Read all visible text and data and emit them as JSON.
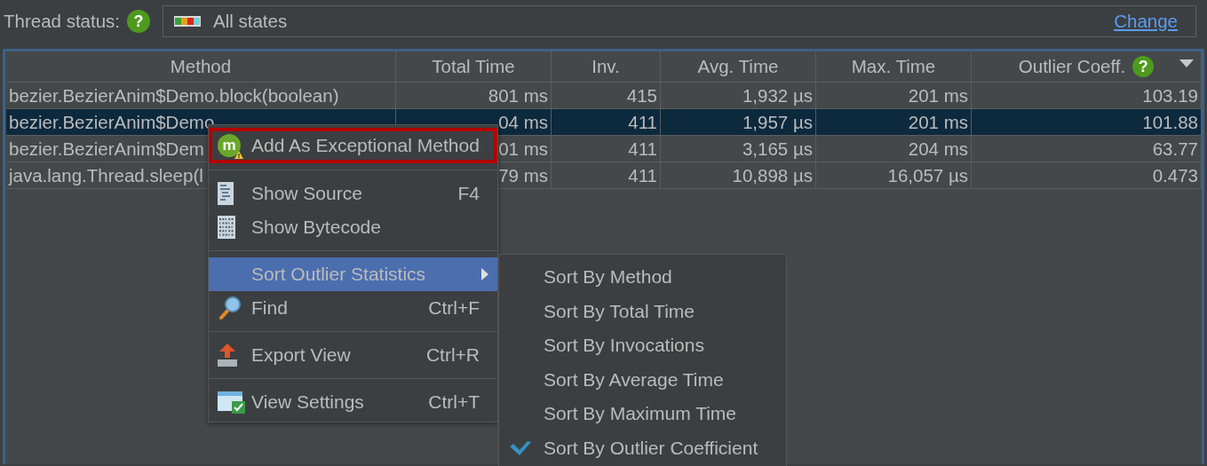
{
  "thread_status": {
    "label": "Thread status:",
    "help": "?",
    "value": "All states",
    "link": "Change"
  },
  "table": {
    "columns": [
      {
        "label": "Method",
        "sorted": false
      },
      {
        "label": "Total Time",
        "sorted": false
      },
      {
        "label": "Inv.",
        "sorted": false
      },
      {
        "label": "Avg. Time",
        "sorted": false
      },
      {
        "label": "Max. Time",
        "sorted": false
      },
      {
        "label": "Outlier Coeff.",
        "help": "?",
        "sorted": true
      }
    ],
    "rows": [
      {
        "selected": false,
        "cells": [
          "bezier.BezierAnim$Demo.block(boolean)",
          "801 ms",
          "415",
          "1,932 µs",
          "201 ms",
          "103.19"
        ]
      },
      {
        "selected": true,
        "cells": [
          "bezier.BezierAnim$Demo",
          "04 ms",
          "411",
          "1,957 µs",
          "201 ms",
          "101.88"
        ]
      },
      {
        "selected": false,
        "cells": [
          "bezier.BezierAnim$Dem",
          "01 ms",
          "411",
          "3,165 µs",
          "204 ms",
          "63.77"
        ]
      },
      {
        "selected": false,
        "cells": [
          "java.lang.Thread.sleep(l",
          "79 ms",
          "411",
          "10,898 µs",
          "16,057 µs",
          "0.473"
        ]
      }
    ]
  },
  "context_menu": {
    "items": [
      {
        "kind": "exceptional",
        "badge": "m",
        "label": "Add As Exceptional Method",
        "outlined": true,
        "selected": false
      },
      {
        "kind": "separator"
      },
      {
        "kind": "source",
        "label": "Show Source",
        "shortcut": "F4",
        "selected": false
      },
      {
        "kind": "bytecode",
        "label": "Show Bytecode",
        "selected": false
      },
      {
        "kind": "separator"
      },
      {
        "kind": "submenu",
        "label": "Sort Outlier Statistics",
        "selected": true
      },
      {
        "kind": "find",
        "label": "Find",
        "shortcut": "Ctrl+F",
        "selected": false
      },
      {
        "kind": "separator"
      },
      {
        "kind": "export",
        "label": "Export View",
        "shortcut": "Ctrl+R",
        "selected": false
      },
      {
        "kind": "separator"
      },
      {
        "kind": "settings",
        "label": "View Settings",
        "shortcut": "Ctrl+T",
        "selected": false
      }
    ]
  },
  "submenu": {
    "items": [
      {
        "label": "Sort By Method",
        "checked": false
      },
      {
        "label": "Sort By Total Time",
        "checked": false
      },
      {
        "label": "Sort By Invocations",
        "checked": false
      },
      {
        "label": "Sort By Average Time",
        "checked": false
      },
      {
        "label": "Sort By Maximum Time",
        "checked": false
      },
      {
        "label": "Sort By Outlier Coefficient",
        "checked": true
      }
    ]
  }
}
